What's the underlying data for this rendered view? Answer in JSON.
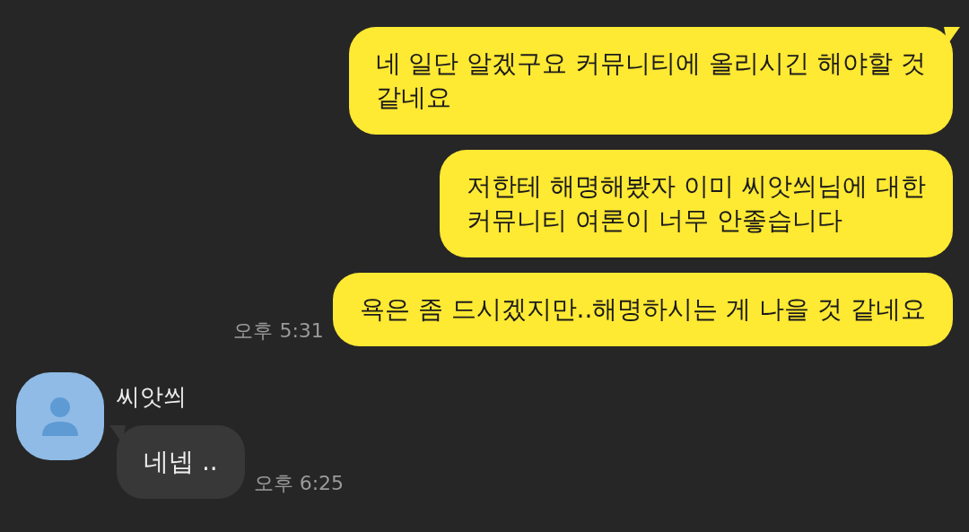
{
  "messages": [
    {
      "kind": "sent",
      "text": "네 일단 알겠구요 커뮤니티에 올리시긴 해야할 것\n같네요",
      "tail": true
    },
    {
      "kind": "sent",
      "text": "저한테 해명해봤자 이미 씨앗씌님에 대한\n커뮤니티 여론이 너무 안좋습니다",
      "tail": false
    },
    {
      "kind": "sent",
      "text": "욕은 좀 드시겠지만..해명하시는 게 나을 것 같네요",
      "tail": false,
      "time": "오후 5:31"
    },
    {
      "kind": "received",
      "sender": "씨앗씌",
      "text": "네넵 ..",
      "tail": true,
      "time": "오후 6:25"
    }
  ]
}
